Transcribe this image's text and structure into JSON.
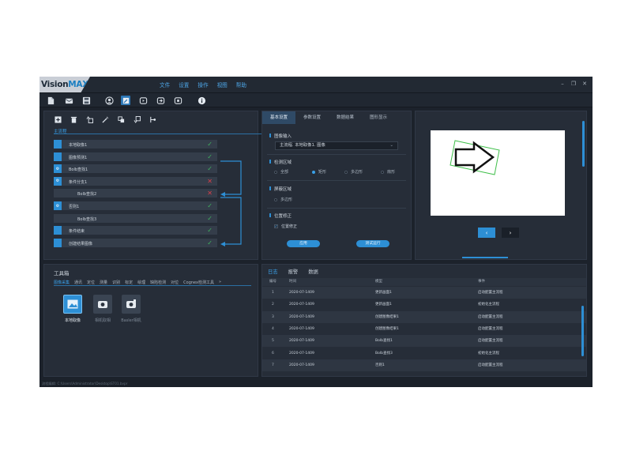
{
  "app": {
    "logo_prefix": "Vision",
    "logo_suffix": "MAX",
    "menu": [
      "文件",
      "设置",
      "操作",
      "视图",
      "帮助"
    ]
  },
  "flow": {
    "tab": "主流程",
    "rows": [
      {
        "label": "本地取像1",
        "status": "ok",
        "indent": false,
        "gear": false
      },
      {
        "label": "图像预测1",
        "status": "ok",
        "indent": false,
        "gear": false
      },
      {
        "label": "Bolb查找1",
        "status": "ok",
        "indent": false,
        "gear": true
      },
      {
        "label": "条件分支1",
        "status": "ng",
        "indent": false,
        "gear": true
      },
      {
        "label": "Bolb查找2",
        "status": "ng",
        "indent": true,
        "gear": false
      },
      {
        "label": "否则1",
        "status": "ok",
        "indent": false,
        "gear": true
      },
      {
        "label": "Bolb查找3",
        "status": "ok",
        "indent": true,
        "gear": false
      },
      {
        "label": "条件结束",
        "status": "ok",
        "indent": false,
        "gear": false
      },
      {
        "label": "创建结果图像",
        "status": "ok",
        "indent": false,
        "gear": false
      }
    ]
  },
  "params": {
    "tabs": [
      "基本设置",
      "参数设置",
      "数据结果",
      "图形显示"
    ],
    "image_input_label": "图像输入",
    "image_input_value": "主流程. 本地取像1. 图像",
    "detect_region_label": "检测区域",
    "detect_options": [
      "全部",
      "矩形",
      "多边形",
      "扇形"
    ],
    "detect_selected": 1,
    "mask_region_label": "屏蔽区域",
    "mask_option": "多边形",
    "pos_fix_label": "位置修正",
    "pos_fix_check": "位置修正",
    "apply_button": "应用",
    "test_button": "测试运行"
  },
  "preview": {
    "prev_icon": "chevron-left",
    "next_icon": "chevron-right"
  },
  "toolbox": {
    "title": "工具箱",
    "tabs": [
      "图像采集",
      "通讯",
      "定位",
      "测量",
      "识别",
      "标定",
      "绘理",
      "缺陷检测",
      "对位",
      "Cognex检测工具",
      "»"
    ],
    "tools": [
      "本地取像",
      "相机取相",
      "Basler相机"
    ]
  },
  "log": {
    "tabs": [
      "日志",
      "报警",
      "数据"
    ],
    "headers": [
      "编号",
      "时间",
      "模型",
      "事件"
    ],
    "rows": [
      {
        "num": "1",
        "time": "2020-07-1409",
        "model": "更新画面1",
        "event": "启动配置主流程"
      },
      {
        "num": "2",
        "time": "2020-07-1409",
        "model": "更新画面1",
        "event": "初始化主流程"
      },
      {
        "num": "3",
        "time": "2020-07-1409",
        "model": "创建图像结果1",
        "event": "启动配置主流程"
      },
      {
        "num": "4",
        "time": "2020-07-1409",
        "model": "创建图像结果1",
        "event": "启动配置主流程"
      },
      {
        "num": "5",
        "time": "2020-07-1409",
        "model": "Bolb查找1",
        "event": "启动配置主流程"
      },
      {
        "num": "6",
        "time": "2020-07-1409",
        "model": "Bolb查找3",
        "event": "初始化主流程"
      },
      {
        "num": "7",
        "time": "2020-07-1409",
        "model": "否则1",
        "event": "启动配置主流程"
      }
    ]
  },
  "status": {
    "path": "流程编辑: C:\\Users\\Administrator\\Desktop\\ST01.bvpr"
  },
  "colors": {
    "accent": "#2d8fd5",
    "ok": "#40b35f",
    "ng": "#d8404a",
    "selection_box": "#3fbf4a"
  }
}
